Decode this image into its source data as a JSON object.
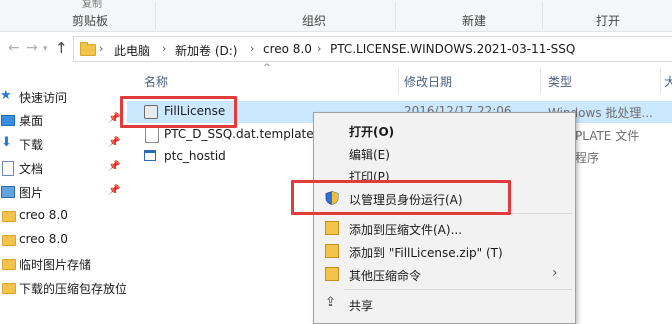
{
  "ribbon": {
    "groups": [
      "剪贴板",
      "组织",
      "新建",
      "打开"
    ],
    "remnant_text": "复制"
  },
  "address": {
    "crumbs": [
      "此电脑",
      "新加卷 (D:)",
      "creo 8.0",
      "PTC.LICENSE.WINDOWS.2021-03-11-SSQ"
    ]
  },
  "sidebar": {
    "items": [
      {
        "label": "快速访问",
        "icon": "star-icon",
        "pinned": false
      },
      {
        "label": "桌面",
        "icon": "desktop-icon",
        "pinned": true
      },
      {
        "label": "下载",
        "icon": "download-icon",
        "pinned": true
      },
      {
        "label": "文档",
        "icon": "document-icon",
        "pinned": true
      },
      {
        "label": "图片",
        "icon": "picture-icon",
        "pinned": true
      },
      {
        "label": "creo 8.0",
        "icon": "folder-icon",
        "pinned": false
      },
      {
        "label": "creo 8.0",
        "icon": "folder-icon",
        "pinned": false
      },
      {
        "label": "临时图片存储",
        "icon": "folder-icon",
        "pinned": false
      },
      {
        "label": "下载的压缩包存放位",
        "icon": "folder-icon",
        "pinned": false
      }
    ]
  },
  "columns": {
    "name": "名称",
    "modified": "修改日期",
    "type": "类型"
  },
  "files": [
    {
      "name": "FillLicense",
      "date": "2016/12/17 22:06",
      "type": "Windows 批处理...",
      "icon": "batch-file-icon"
    },
    {
      "name": "PTC_D_SSQ.dat.template",
      "date": "",
      "type": "PLATE 文件",
      "icon": "template-file-icon"
    },
    {
      "name": "ptc_hostid",
      "date": "",
      "type": "程序",
      "icon": "app-icon"
    }
  ],
  "context_menu": {
    "items": [
      {
        "label": "打开(O)",
        "bold": true
      },
      {
        "label": "编辑(E)",
        "bold": false
      },
      {
        "label": "打印(P)",
        "bold": false
      },
      {
        "label": "以管理员身份运行(A)",
        "bold": false,
        "icon": "shield-icon"
      },
      {
        "label": "添加到压缩文件(A)...",
        "bold": false,
        "icon": "archive-icon"
      },
      {
        "label": "添加到 \"FillLicense.zip\" (T)",
        "bold": false,
        "icon": "archive-icon"
      },
      {
        "label": "其他压缩命令",
        "bold": false,
        "icon": "archive-icon",
        "submenu": true
      },
      {
        "label": "共享",
        "bold": false,
        "icon": "share-icon"
      }
    ]
  },
  "colors": {
    "highlight_red": "#e23b3b",
    "selection_blue": "#cce8ff",
    "folder_yellow": "#f3c44a"
  }
}
